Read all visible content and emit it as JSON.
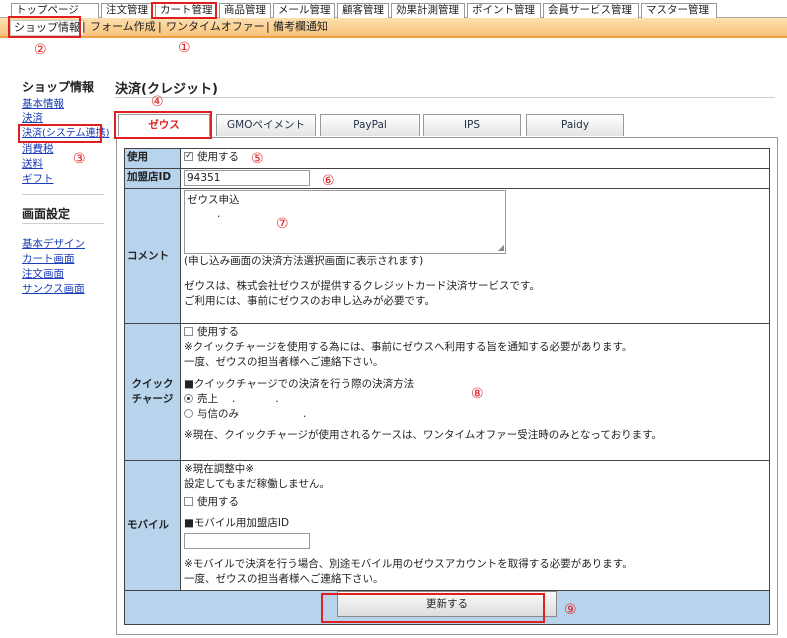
{
  "topnav": {
    "tabs": [
      "トップページ",
      "注文管理",
      "カート管理",
      "商品管理",
      "メール管理",
      "顧客管理",
      "効果計測管理",
      "ポイント管理",
      "会員サービス管理",
      "マスター管理"
    ]
  },
  "subnav": {
    "items": [
      "ショップ情報",
      "フォーム作成",
      "ワンタイムオファー",
      "備考欄通知"
    ],
    "separator": "|"
  },
  "annotations": [
    "①",
    "②",
    "③",
    "④",
    "⑤",
    "⑥",
    "⑦",
    "⑧",
    "⑨"
  ],
  "sidebar": {
    "shop_heading": "ショップ情報",
    "shop_links": [
      "基本情報",
      "決済",
      "決済(システム連携)",
      "消費税",
      "送料",
      "ギフト"
    ],
    "screen_heading": "画面設定",
    "screen_links": [
      "基本デザイン",
      "カート画面",
      "注文画面",
      "サンクス画面"
    ]
  },
  "main": {
    "title": "決済(クレジット)",
    "tabs": [
      "ゼウス",
      "GMOペイメント",
      "PayPal",
      "IPS",
      "Paidy"
    ]
  },
  "form": {
    "use": {
      "label": "使用",
      "checkbox": "使用する",
      "checked": true
    },
    "merchant": {
      "label": "加盟店ID",
      "value": "94351"
    },
    "comment": {
      "label": "コメント",
      "value_line1": "ゼウス申込",
      "value_line2": ".",
      "note": "(申し込み画面の決済方法選択画面に表示されます)",
      "desc1": "ゼウスは、株式会社ゼウスが提供するクレジットカード決済サービスです。",
      "desc2": "ご利用には、事前にゼウスのお申し込みが必要です。"
    },
    "quick": {
      "label": "クイックチャージ",
      "checkbox": "使用する",
      "checked": false,
      "note1": "※クイックチャージを使用する為には、事前にゼウスへ利用する旨を通知する必要があります。",
      "note2": "一度、ゼウスの担当者様へご連絡下さい。",
      "method_heading": "■クイックチャージでの決済を行う際の決済方法",
      "options": [
        "売上",
        "与信のみ"
      ],
      "selected": 0,
      "dot": ".",
      "note3": "※現在、クイックチャージが使用されるケースは、ワンタイムオファー受注時のみとなっております。"
    },
    "mobile": {
      "label": "モバイル",
      "status1": "※現在調整中※",
      "status2": "設定してもまだ稼働しません。",
      "checkbox": "使用する",
      "checked": false,
      "id_heading": "■モバイル用加盟店ID",
      "id_value": "",
      "note1": "※モバイルで決済を行う場合、別途モバイル用のゼウスアカウントを取得する必要があります。",
      "note2": "一度、ゼウスの担当者様へご連絡下さい。"
    },
    "submit_label": "更新する"
  }
}
